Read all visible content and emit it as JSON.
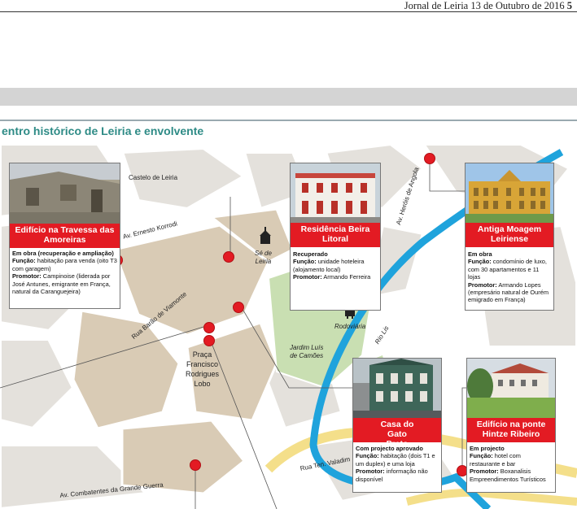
{
  "header": {
    "publication": "Jornal de Leiria 13 de Outubro de 2016",
    "page_number": "5"
  },
  "map": {
    "title": "entro histórico de Leiria e envolvente",
    "places": {
      "castelo": "Castelo de Leiria",
      "se": "Sé de\nLeiria",
      "rodoviaria": "Rodoviária",
      "jardim": "Jardim Luís\nde Camões",
      "praca": "Praça\nFrancisco\nRodrigues\nLobo"
    },
    "streets": {
      "kórrodi": "Av. Ernesto Korrodi",
      "viamonte": "Rua Barão de Viamonte",
      "herois": "Av. Heróis de Angola",
      "lis": "Rio Lis",
      "valadim": "Rua Ten. Valadim",
      "guerra": "Av. Combatentes da Grande Guerra"
    },
    "colors": {
      "road": "#ffffff",
      "block_light": "#e4e1dc",
      "block_tan": "#d9cbb5",
      "park": "#c9dfb2",
      "river": "#1fa3dc",
      "main_road": "#f4df8a",
      "pin": "#e31b23",
      "title": "#2e8b86"
    }
  },
  "cards": {
    "amoreiras": {
      "title": "Edifício na Travessa das Amoreiras",
      "status": "Em obra (recuperação e ampliação)",
      "funcao_label": "Função:",
      "funcao": " habitação para venda (oito T3 com garagem)",
      "promotor_label": "Promotor:",
      "promotor": " Campinoise (liderada por José Antunes, emigrante em França, natural da Caranguejeira)"
    },
    "beira": {
      "title": "Residência Beira Litoral",
      "status": "Recuperado",
      "funcao_label": "Função:",
      "funcao": " unidade hoteleira (alojamento local)",
      "promotor_label": "Promotor:",
      "promotor": " Armando Ferreira"
    },
    "moagem": {
      "title": "Antiga Moagem Leiriense",
      "status": "Em obra",
      "funcao_label": "Função:",
      "funcao": " condomínio de luxo, com 30 apartamentos e 11 lojas",
      "promotor_label": "Promotor:",
      "promotor": " Armando Lopes (empresário natural de Ourém emigrado em França)"
    },
    "gato": {
      "title": "Casa do Gato Preto",
      "status": "Com projecto aprovado",
      "funcao_label": "Função:",
      "funcao": " habitação (dois T1 e um duplex) e uma loja",
      "promotor_label": "Promotor:",
      "promotor": " informação não disponível"
    },
    "hintze": {
      "title": "Edifício na ponte Hintze Ribeiro",
      "status": "Em projecto",
      "funcao_label": "Função:",
      "funcao": " hotel com restaurante e bar",
      "promotor_label": "Promotor:",
      "promotor": " Boxanalisis Empreendimentos Turísticos"
    }
  }
}
